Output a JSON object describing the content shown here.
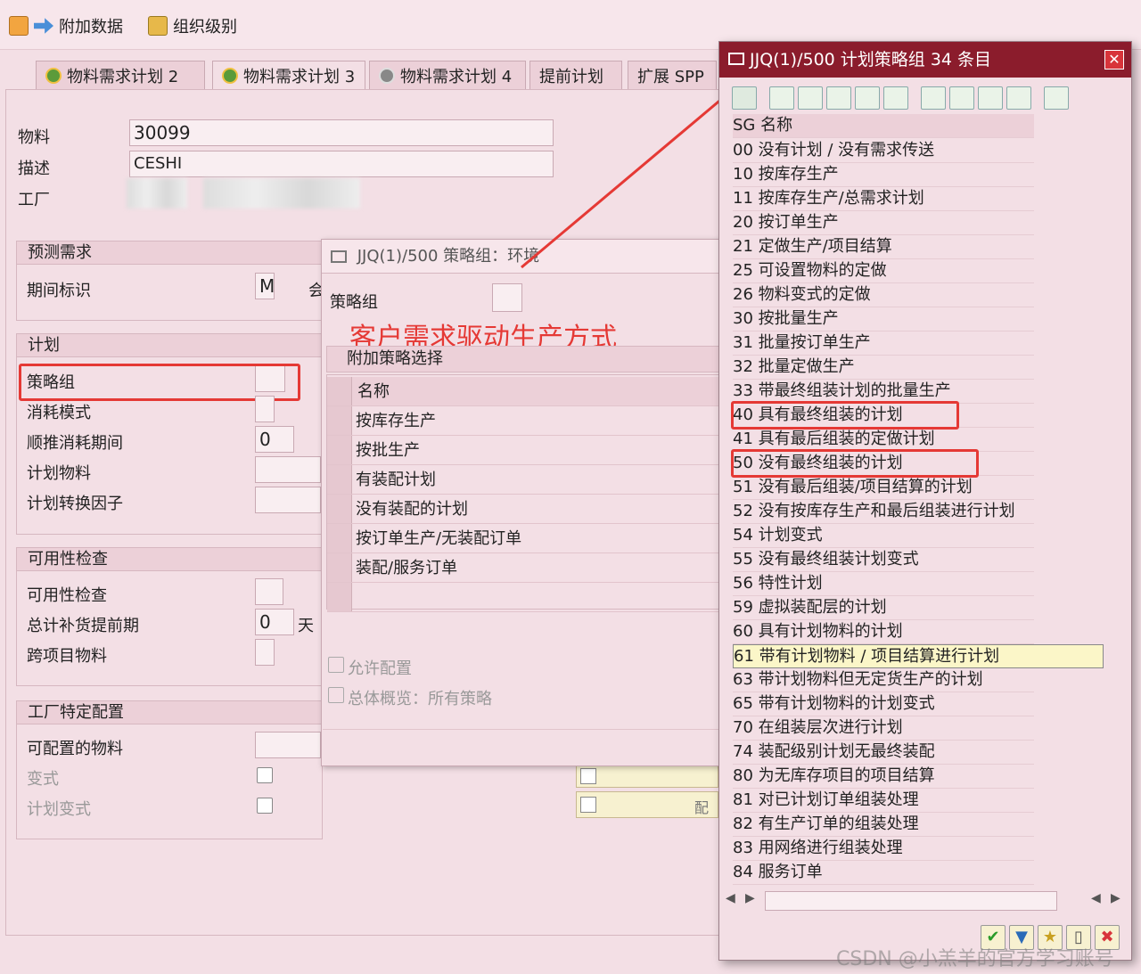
{
  "toolbar": {
    "btn_additional": "附加数据",
    "btn_org_levels": "组织级别"
  },
  "tabs": [
    "物料需求计划 2",
    "物料需求计划 3",
    "物料需求计划 4",
    "提前计划",
    "扩展 SPP"
  ],
  "main": {
    "material_label": "物料",
    "material_value": "30099",
    "desc_label": "描述",
    "desc_value": "CESHI",
    "plant_label": "工厂",
    "forecast_group": "预测需求",
    "period_label": "期间标识",
    "period_value": "M",
    "period_extra": "会",
    "plan_group": "计划",
    "strategy_label": "策略组",
    "consumption_label": "消耗模式",
    "backward_label": "顺推消耗期间",
    "backward_value": "0",
    "planning_material_label": "计划物料",
    "conversion_label": "计划转换因子",
    "avail_group": "可用性检查",
    "avail_label": "可用性检查",
    "replenish_label": "总计补货提前期",
    "replenish_value": "0",
    "replenish_unit": "天",
    "cross_label": "跨项目物料",
    "plant_config_group": "工厂特定配置",
    "configurable_label": "可配置的物料",
    "variant_label": "变式",
    "plan_variant_label": "计划变式",
    "config_partial": "配"
  },
  "dialog1": {
    "title": "JJQ(1)/500 策略组：环境",
    "strategy_label": "策略组",
    "annotation": "客户需求驱动生产方式",
    "section": "附加策略选择",
    "col_name": "名称",
    "rows": [
      "按库存生产",
      "按批生产",
      "有装配计划",
      "没有装配的计划",
      "按订单生产/无装配订单",
      "装配/服务订单"
    ],
    "allow_config": "允许配置",
    "overview": "总体概览：所有策略"
  },
  "dialog2": {
    "title": "JJQ(1)/500 计划策略组 34 条目",
    "header": "SG 名称",
    "rows": [
      "00 没有计划 / 没有需求传送",
      "10 按库存生产",
      "11 按库存生产/总需求计划",
      "20 按订单生产",
      "21 定做生产/项目结算",
      "25 可设置物料的定做",
      "26 物料变式的定做",
      "30 按批量生产",
      "31 批量按订单生产",
      "32 批量定做生产",
      "33 带最终组装计划的批量生产",
      "40 具有最终组装的计划",
      "41 具有最后组装的定做计划",
      "50 没有最终组装的计划",
      "51 没有最后组装/项目结算的计划",
      "52 没有按库存生产和最后组装进行计划",
      "54 计划变式",
      "55 没有最终组装计划变式",
      "56 特性计划",
      "59 虚拟装配层的计划",
      "60 具有计划物料的计划",
      "61 带有计划物料 / 项目结算进行计划",
      "63 带计划物料但无定货生产的计划",
      "65 带有计划物料的计划变式",
      "70 在组装层次进行计划",
      "74 装配级别计划无最终装配",
      "80 为无库存项目的项目结算",
      "81 对已计划订单组装处理",
      "82 有生产订单的组装处理",
      "83 用网络进行组装处理",
      "84 服务订单"
    ]
  },
  "watermark": "CSDN @小羔羊的官方学习账号"
}
